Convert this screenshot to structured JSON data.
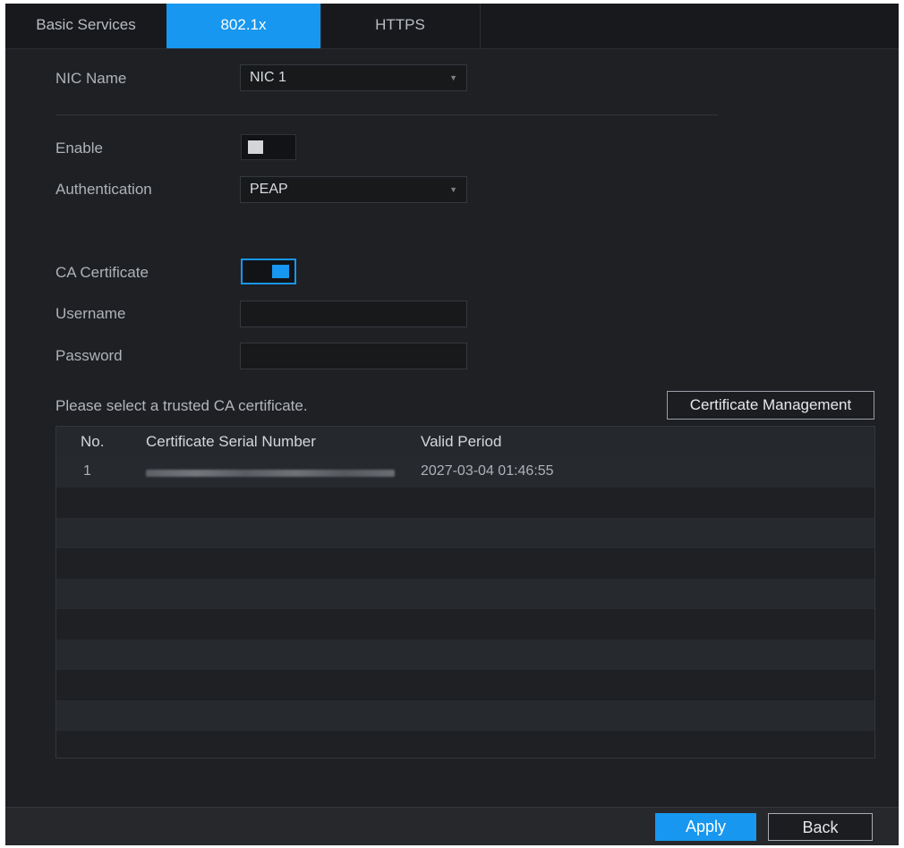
{
  "tabs": [
    {
      "label": "Basic Services",
      "active": false
    },
    {
      "label": "802.1x",
      "active": true
    },
    {
      "label": "HTTPS",
      "active": false
    }
  ],
  "form": {
    "nic_name_label": "NIC Name",
    "nic_name_value": "NIC 1",
    "enable_label": "Enable",
    "enable_state": "off",
    "authentication_label": "Authentication",
    "authentication_value": "PEAP",
    "ca_certificate_label": "CA Certificate",
    "ca_certificate_state": "on",
    "username_label": "Username",
    "username_value": "",
    "password_label": "Password",
    "password_value": ""
  },
  "certificates": {
    "hint": "Please select a trusted CA certificate.",
    "management_button": "Certificate Management",
    "columns": [
      "No.",
      "Certificate Serial Number",
      "Valid Period"
    ],
    "rows": [
      {
        "no": "1",
        "serial": "",
        "valid_period": "2027-03-04 01:46:55"
      }
    ]
  },
  "footer": {
    "apply_label": "Apply",
    "back_label": "Back"
  },
  "colors": {
    "accent": "#1797ef",
    "background": "#1e2024"
  },
  "icons": {
    "dropdown": "chevron-down-icon"
  }
}
